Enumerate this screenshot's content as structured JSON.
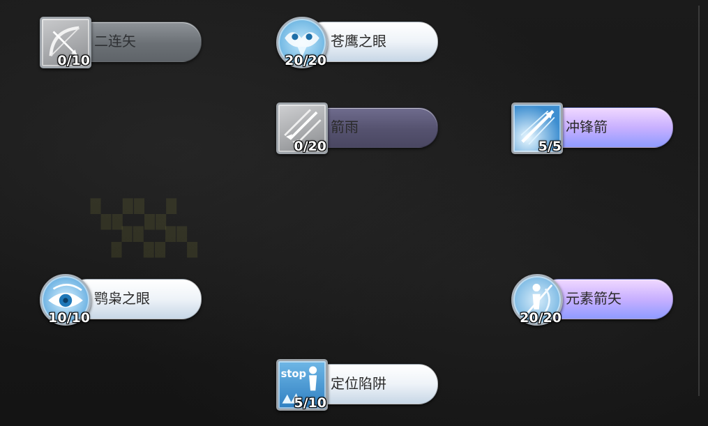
{
  "skills": [
    {
      "name": "二连矢",
      "count": "0/10"
    },
    {
      "name": "苍鹰之眼",
      "count": "20/20"
    },
    {
      "name": "箭雨",
      "count": "0/20"
    },
    {
      "name": "冲锋箭",
      "count": "5/5"
    },
    {
      "name": "鹗枭之眼",
      "count": "10/10"
    },
    {
      "name": "元素箭矢",
      "count": "20/20"
    },
    {
      "name": "定位陷阱",
      "count": "5/10",
      "icon_text": "stop"
    }
  ],
  "colors": {
    "inactive_bar": "#6b7075",
    "inactive_purple_bar": "#55526f",
    "active_bar": "#eef3f8",
    "upgraded_bar": "#c8b0ff",
    "icon_blue": "#4fa3d8"
  },
  "icons": {
    "s0": "bow-icon",
    "s1": "hawk-eye-icon",
    "s2": "arrow-rain-icon",
    "s3": "charge-arrow-icon",
    "s4": "owl-eye-icon",
    "s5": "elemental-arrow-icon",
    "s6": "trap-stop-icon"
  }
}
